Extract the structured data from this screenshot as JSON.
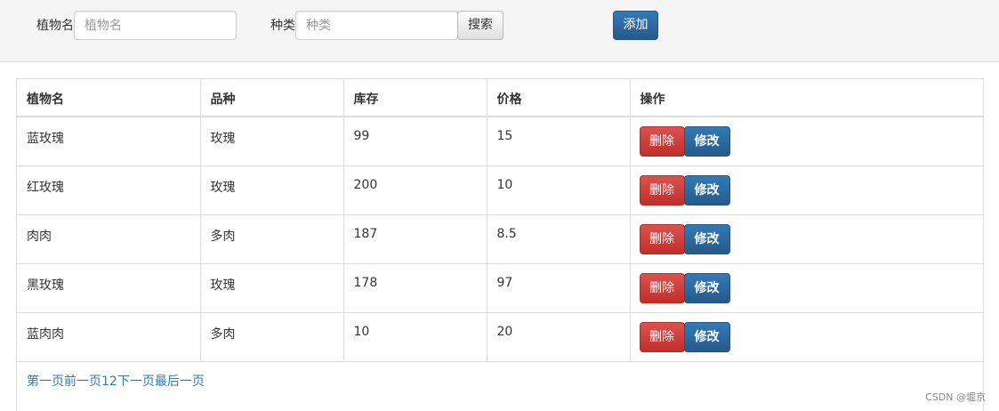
{
  "search": {
    "name_label": "植物名",
    "name_placeholder": "植物名",
    "type_label": "种类",
    "type_placeholder": "种类",
    "search_button": "搜索",
    "add_button": "添加"
  },
  "table": {
    "headers": [
      "植物名",
      "品种",
      "库存",
      "价格",
      "操作"
    ],
    "rows": [
      {
        "name": "蓝玫瑰",
        "variety": "玫瑰",
        "stock": "99",
        "price": "15"
      },
      {
        "name": "红玫瑰",
        "variety": "玫瑰",
        "stock": "200",
        "price": "10"
      },
      {
        "name": "肉肉",
        "variety": "多肉",
        "stock": "187",
        "price": "8.5"
      },
      {
        "name": "黑玫瑰",
        "variety": "玫瑰",
        "stock": "178",
        "price": "97"
      },
      {
        "name": "蓝肉肉",
        "variety": "多肉",
        "stock": "10",
        "price": "20"
      }
    ],
    "delete_label": "删除",
    "edit_label": "修改"
  },
  "pagination": {
    "first": "第一页",
    "prev": "前一页",
    "page1": "1",
    "page2": "2",
    "next": "下一页",
    "last": "最后一页"
  },
  "colors": {
    "primary": "#337ab7",
    "danger": "#d9534f",
    "link": "#337ab7"
  },
  "watermark": "CSDN @堀京"
}
